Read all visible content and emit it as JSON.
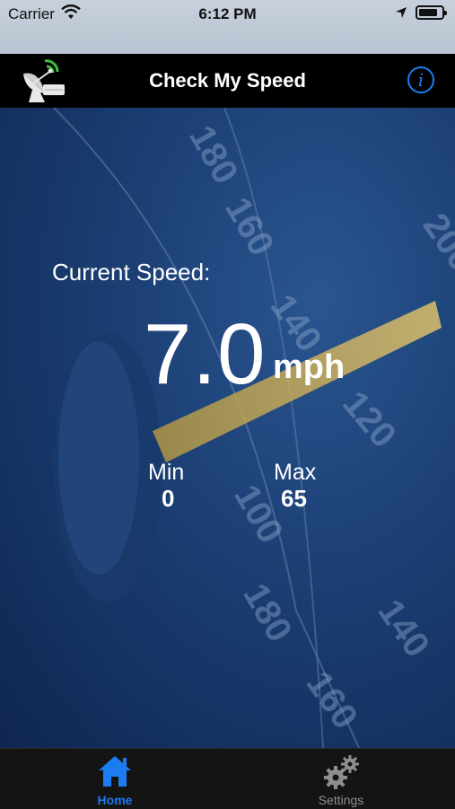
{
  "status_bar": {
    "carrier": "Carrier",
    "time": "6:12 PM"
  },
  "nav": {
    "title": "Check My Speed",
    "info_icon": "info-icon",
    "logo_icon": "satellite-dish-icon"
  },
  "speed": {
    "label": "Current Speed:",
    "value": "7.0",
    "unit": "mph"
  },
  "stats": {
    "min_label": "Min",
    "min_value": "0",
    "max_label": "Max",
    "max_value": "65"
  },
  "tabs": [
    {
      "label": "Home",
      "icon": "home-icon",
      "active": true
    },
    {
      "label": "Settings",
      "icon": "gear-icon",
      "active": false
    }
  ],
  "colors": {
    "accent": "#1c7cf2",
    "background": "#1b3e73",
    "nav": "#000000"
  }
}
